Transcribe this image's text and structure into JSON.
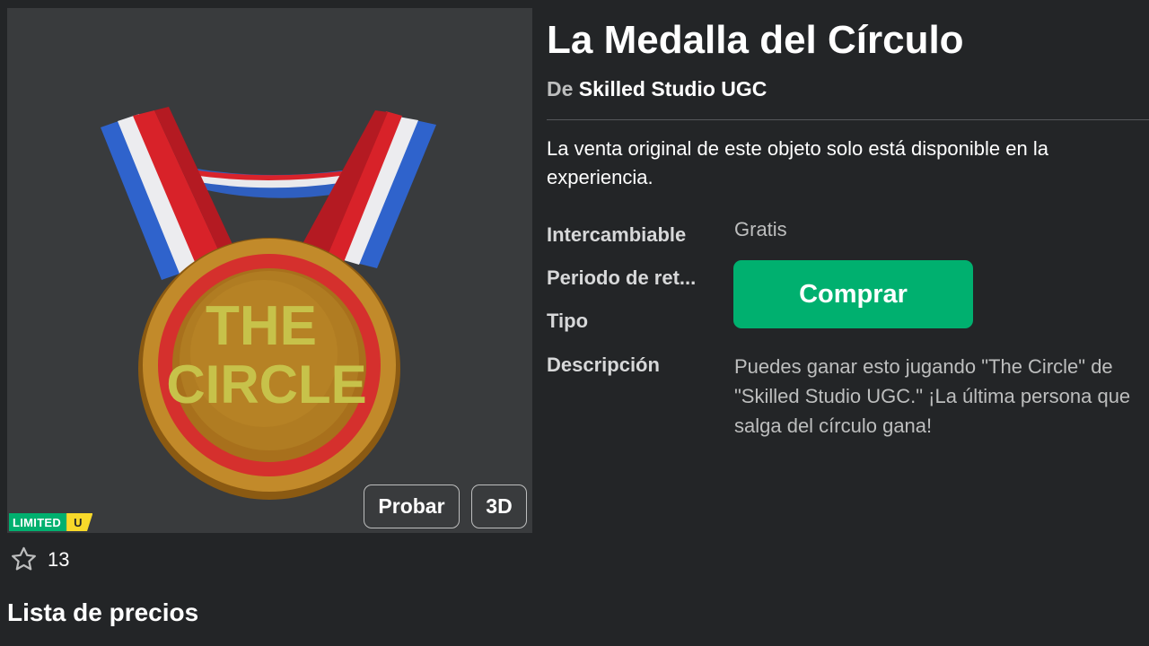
{
  "item": {
    "title": "La Medalla del Círculo",
    "by_prefix": "De",
    "creator": "Skilled Studio UGC",
    "sale_note_line1": "La venta original de este objeto solo está disponible en la",
    "sale_note_line2": "experiencia.",
    "details": {
      "tradable_label": "Intercambiable",
      "tradable_value": "Gratis",
      "hold_period_label": "Periodo de ret...",
      "type_label": "Tipo",
      "description_label": "Descripción",
      "description_lines": [
        "Puedes ganar esto jugando \"The Circle\" de",
        "\"Skilled Studio UGC.\" ¡La última persona que",
        "salga del círculo gana!"
      ]
    },
    "buy_label": "Comprar"
  },
  "thumbnail": {
    "try_on_label": "Probar",
    "view_3d_label": "3D",
    "badge_limited": "LIMITED",
    "badge_u": "U",
    "medal_text_line1": "THE",
    "medal_text_line2": "CIRCLE"
  },
  "favorites": {
    "count": "13"
  },
  "sections": {
    "price_list": "Lista de precios"
  },
  "colors": {
    "background": "#232527",
    "thumbnail_bg": "#393b3d",
    "buy_green": "#00b06f",
    "limited_yellow": "#f8d92a"
  },
  "icons": {
    "favorite": "star-outline-icon"
  }
}
